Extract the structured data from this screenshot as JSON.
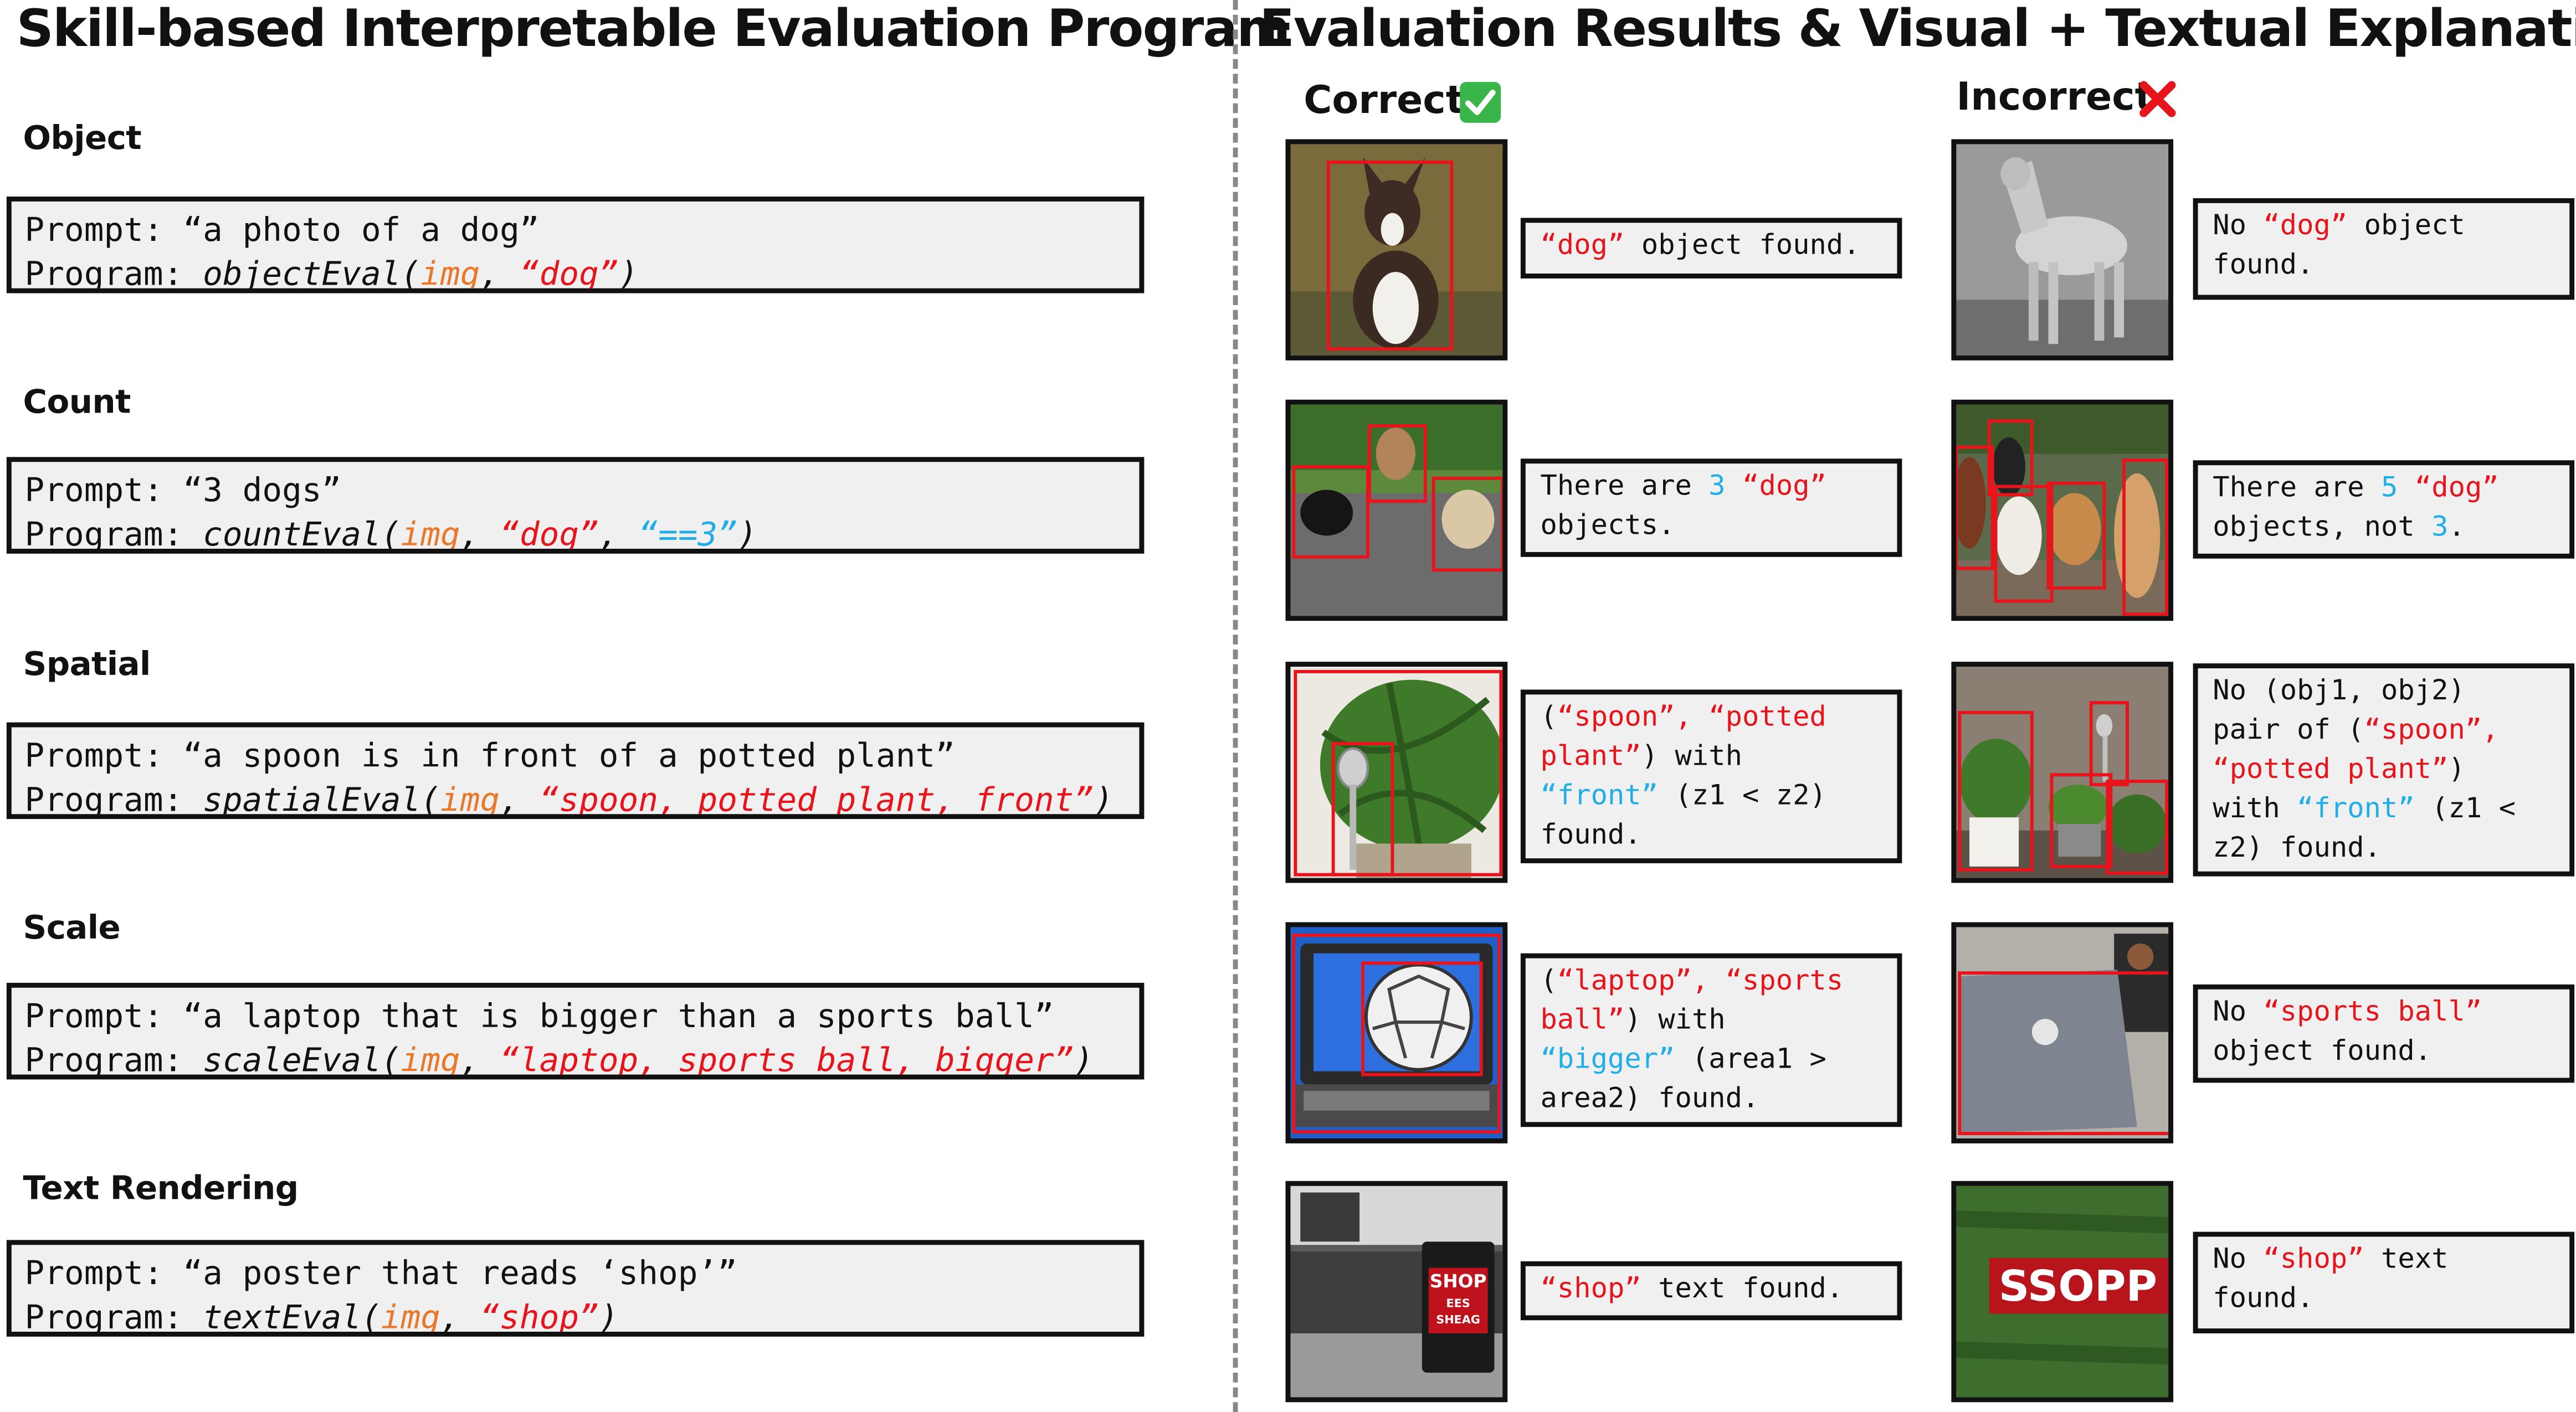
{
  "left_title": "Skill-based Interpretable Evaluation Program",
  "right_title": "Evaluation Results & Visual + Textual Explanation",
  "correct_label": "Correct",
  "incorrect_label": "Incorrect",
  "check_icon": "check-icon",
  "cross_icon": "cross-icon",
  "colors": {
    "orange": "#e8782a",
    "red": "#e8141c",
    "blue": "#21aee8"
  },
  "prompt_label": "Prompt:",
  "program_label": "Program:",
  "skills": [
    {
      "name": "Object",
      "prompt": "“a photo of a dog”",
      "fn": "objectEval(",
      "img": "img",
      "arg1": "“dog”",
      "close": ")",
      "correct_text": {
        "a": "“dog”",
        "b": " object found."
      },
      "incorrect_text": {
        "a": "No ",
        "b": "“dog”",
        "c": " object",
        "d": "found."
      }
    },
    {
      "name": "Count",
      "prompt": "“3 dogs”",
      "fn": "countEval(",
      "img": "img",
      "arg1": "“dog”",
      "arg2": "“==3”",
      "close": ")",
      "correct_text": {
        "a": "There are ",
        "b": "3",
        "c": "“dog”",
        "d": "objects."
      },
      "incorrect_text": {
        "a": "There are ",
        "b": "5",
        "c": "“dog”",
        "d": "objects, not ",
        "e": "3",
        "f": "."
      }
    },
    {
      "name": "Spatial",
      "prompt": "“a spoon is in front of a potted plant”",
      "fn": "spatialEval(",
      "img": "img",
      "arg1": "“spoon, potted plant, front”",
      "close": ")",
      "correct_text": {
        "a": "(",
        "b": "“spoon”, “potted",
        "c": "plant”",
        "d": ") with",
        "e": "“front”",
        "f": " (z1 < z2)",
        "g": "found."
      },
      "incorrect_text": {
        "a": "No (obj1, obj2)",
        "b": "pair of (",
        "c": "“spoon”,",
        "d": "“potted plant”",
        "e": ")",
        "f": "with ",
        "g": "“front”",
        "h": " (z1 <",
        "i": "z2) found."
      }
    },
    {
      "name": "Scale",
      "prompt": "“a laptop that is bigger than a sports ball”",
      "fn": "scaleEval(",
      "img": "img",
      "arg1": "“laptop, sports ball, bigger”",
      "close": ")",
      "correct_text": {
        "a": "(",
        "b": "“laptop”, “sports",
        "c": "ball”",
        "d": ") with",
        "e": "“bigger”",
        "f": " (area1 >",
        "g": "area2) found."
      },
      "incorrect_text": {
        "a": "No ",
        "b": "“sports ball”",
        "c": "object found."
      }
    },
    {
      "name": "Text Rendering",
      "prompt": "“a poster that reads ‘shop’”",
      "fn": "textEval(",
      "img": "img",
      "arg1": "“shop”",
      "close": ")",
      "correct_text": {
        "a": "“shop”",
        "b": " text found."
      },
      "incorrect_text": {
        "a": "No ",
        "b": "“shop”",
        "c": " text",
        "d": "found."
      }
    }
  ],
  "photo_text": {
    "poster_line1": "SHOP",
    "poster_line2": "EES",
    "poster_line3": "SHEAG",
    "banner": "SSOPP"
  }
}
